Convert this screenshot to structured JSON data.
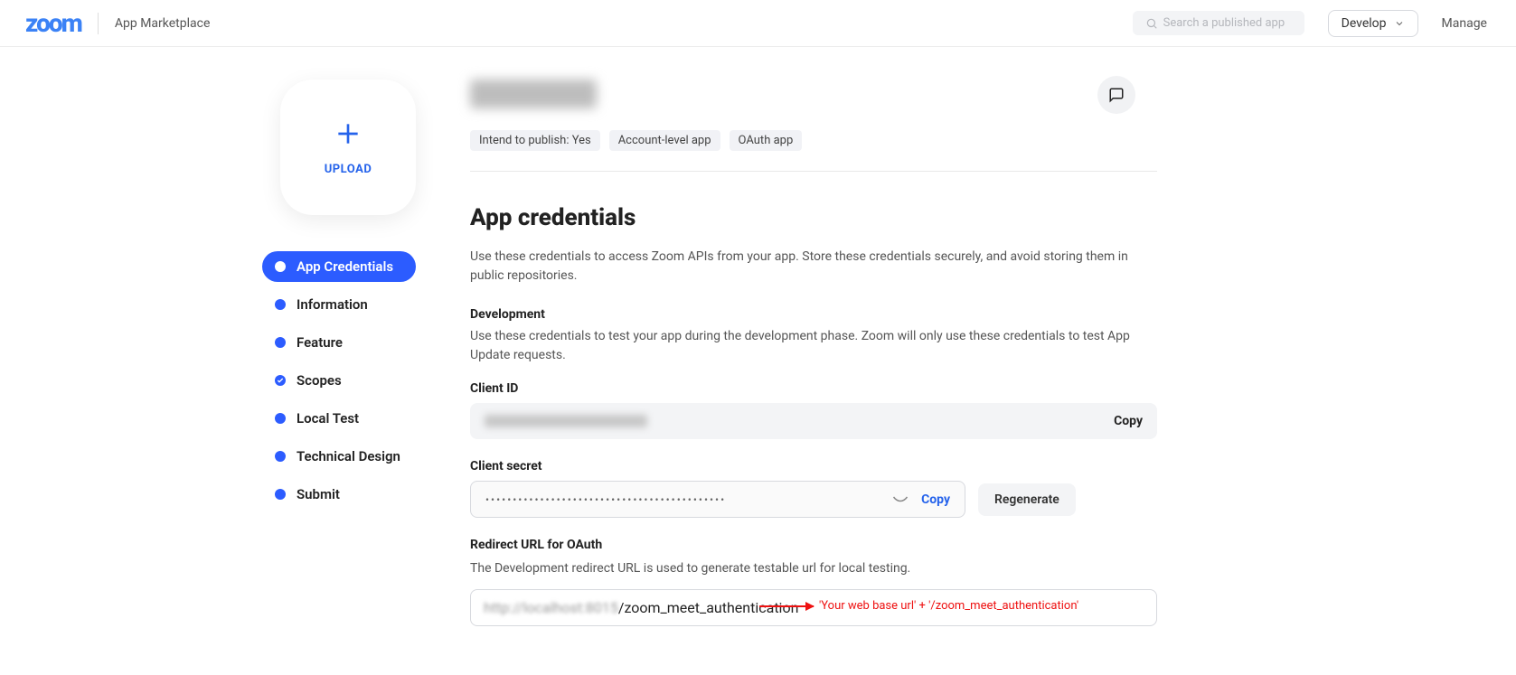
{
  "header": {
    "logo": "zoom",
    "sub": "App Marketplace",
    "search_placeholder": "Search a published app",
    "develop": "Develop",
    "manage": "Manage"
  },
  "upload": {
    "label": "UPLOAD"
  },
  "nav": {
    "app_credentials": "App Credentials",
    "information": "Information",
    "feature": "Feature",
    "scopes": "Scopes",
    "local_test": "Local Test",
    "technical_design": "Technical Design",
    "submit": "Submit"
  },
  "badges": {
    "publish": "Intend to publish: Yes",
    "level": "Account-level app",
    "type": "OAuth app"
  },
  "credentials": {
    "heading": "App credentials",
    "desc": "Use these credentials to access Zoom APIs from your app. Store these credentials securely, and avoid storing them in public repositories.",
    "dev_h": "Development",
    "dev_d": "Use these credentials to test your app during the development phase. Zoom will only use these credentials to test App Update requests.",
    "client_id_label": "Client ID",
    "copy": "Copy",
    "client_secret_label": "Client secret",
    "secret_masked": "••••••••••••••••••••••••••••••••••••••••••••",
    "regenerate": "Regenerate",
    "redirect_label": "Redirect URL for OAuth",
    "redirect_desc": "The Development redirect URL is used to generate testable url for local testing.",
    "redirect_blurred": "http://localhost:8015",
    "redirect_clear": "/zoom_meet_authentication",
    "annotation": "'Your web base url' + '/zoom_meet_authentication'"
  }
}
